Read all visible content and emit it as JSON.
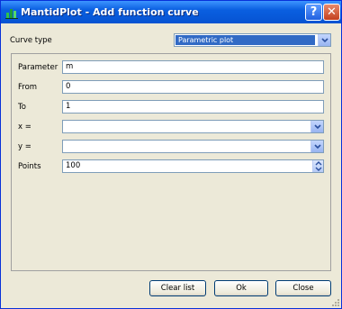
{
  "window": {
    "title": "MantidPlot - Add function curve",
    "help_glyph": "?",
    "close_glyph": "✕",
    "icons": {
      "app": "mantidplot-app-icon",
      "help": "help-icon",
      "close": "close-icon"
    }
  },
  "curve_type": {
    "label": "Curve type",
    "value": "Parametric plot"
  },
  "form": {
    "parameter": {
      "label": "Parameter",
      "value": "m"
    },
    "from": {
      "label": "From",
      "value": "0"
    },
    "to": {
      "label": "To",
      "value": "1"
    },
    "x": {
      "label": "x =",
      "value": ""
    },
    "y": {
      "label": "y =",
      "value": ""
    },
    "points": {
      "label": "Points",
      "value": "100"
    }
  },
  "buttons": {
    "clear": "Clear list",
    "ok": "Ok",
    "close": "Close"
  },
  "colors": {
    "titlebar": "#0653d2",
    "selection": "#316ac5",
    "dialog_bg": "#ece9d8",
    "field_border": "#7f9db9"
  }
}
